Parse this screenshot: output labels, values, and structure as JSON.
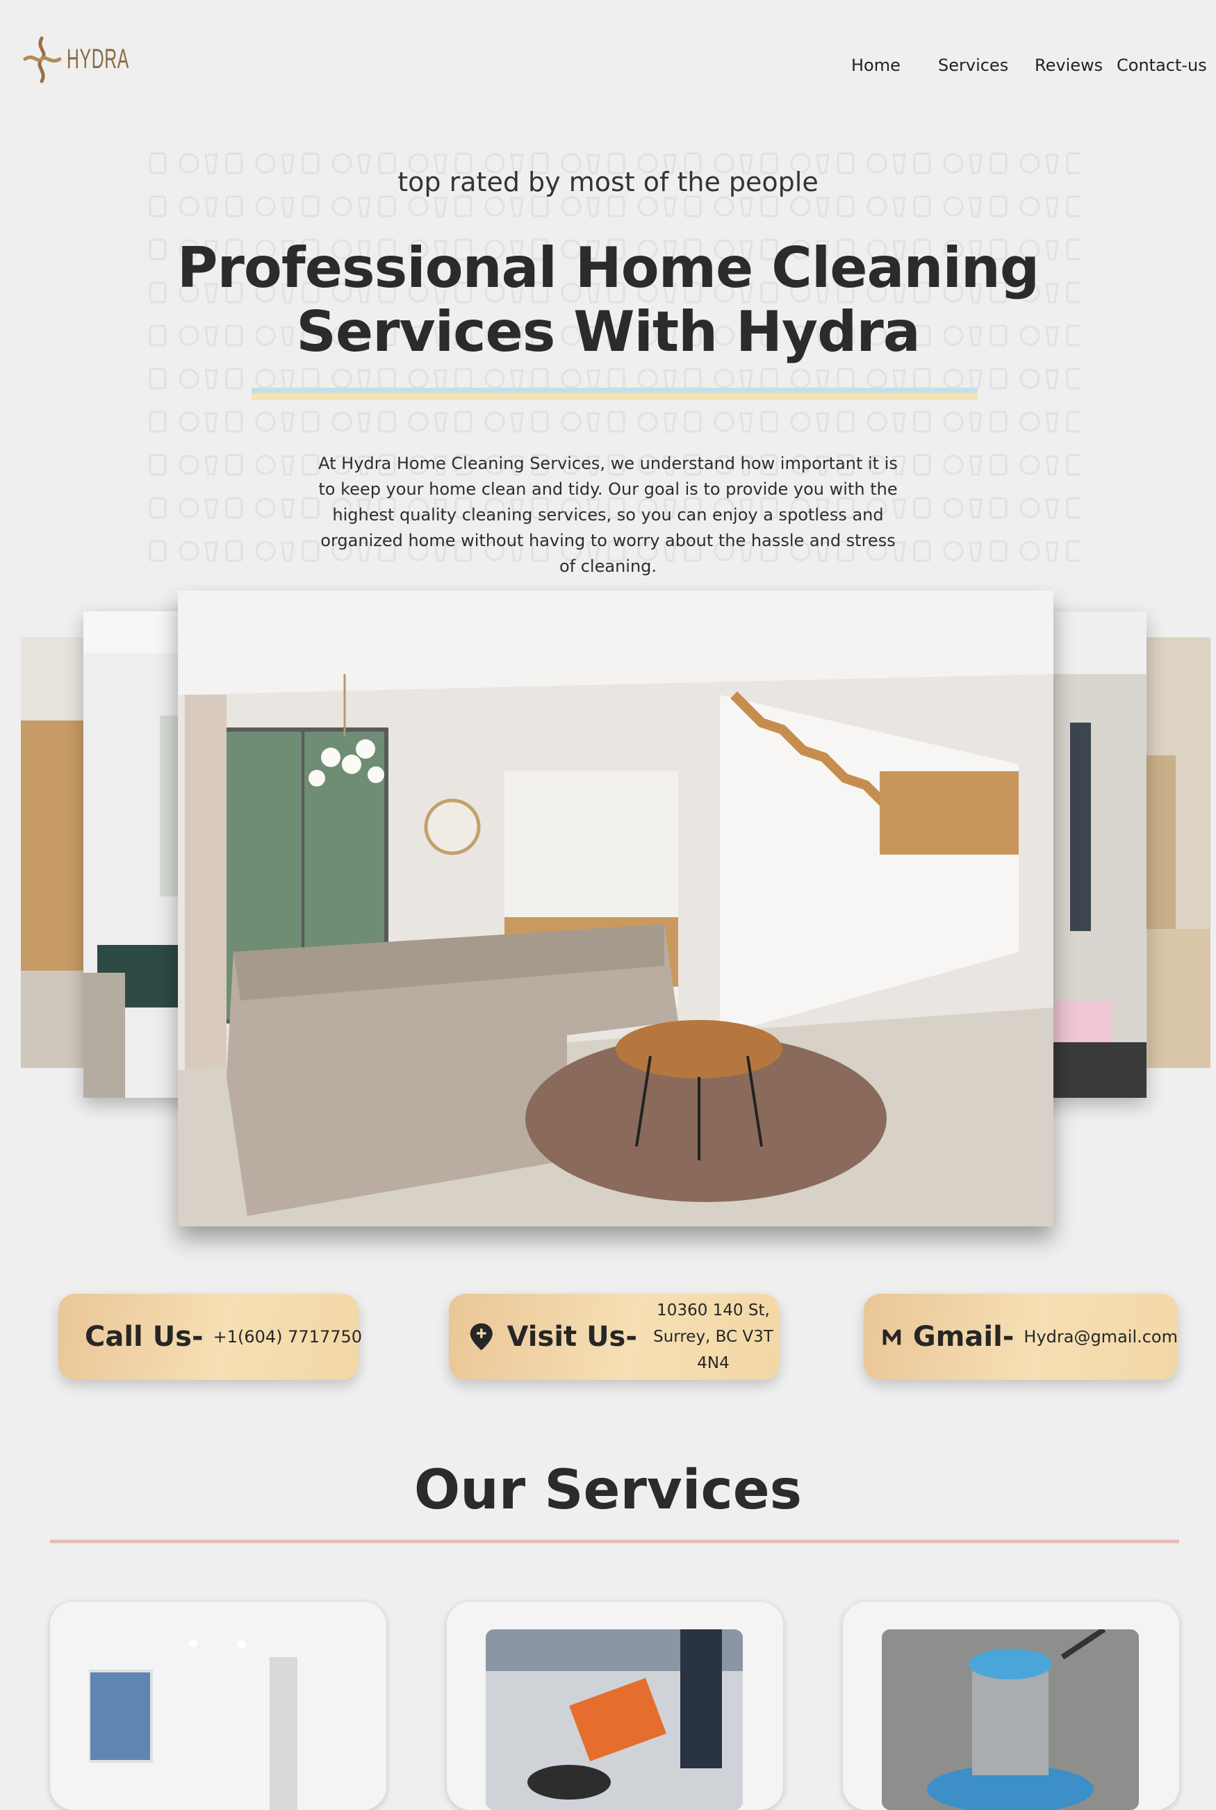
{
  "header": {
    "logo_text": "HYDRA",
    "nav": [
      "Home",
      "Services",
      "Reviews",
      "Contact-us"
    ]
  },
  "hero": {
    "tagline": "top rated by most of the people",
    "title_line1": "Professional Home Cleaning",
    "title_line2": "Services With Hydra",
    "description": "At Hydra Home Cleaning Services, we understand how important it is to keep your home clean and tidy. Our goal is to provide you with the highest quality cleaning services, so you can enjoy a spotless and organized home without having to worry about the hassle and stress of cleaning."
  },
  "contact": {
    "call_label": "Call Us-",
    "call_value": "+1(604) 7717750",
    "visit_label": "Visit Us-",
    "visit_line1": "10360 140 St,",
    "visit_line2": "Surrey, BC V3T 4N4",
    "mail_label": "Gmail-",
    "mail_value": "Hydra@gmail.com"
  },
  "services": {
    "title": "Our Services"
  },
  "icons": {
    "logo": "hydra-swirl-icon",
    "call": "phone-add-icon",
    "visit": "location-pin-icon",
    "mail": "gmail-m-icon"
  },
  "colors": {
    "background": "#efefef",
    "accent_gold": "#eac697",
    "brand_brown": "#8a6a45",
    "rule_blue": "#c5dfe6",
    "rule_yellow": "#f4e4b0",
    "services_rule": "#e8bcb6"
  }
}
